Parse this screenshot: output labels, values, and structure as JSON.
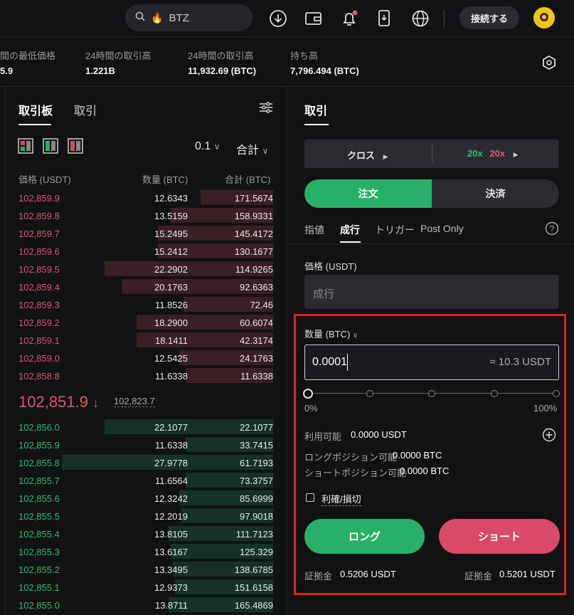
{
  "search": {
    "value": "BTZ"
  },
  "header": {
    "connect_label": "接続する"
  },
  "stats": [
    {
      "label": "間の最低価格",
      "value": "5.9"
    },
    {
      "label": "24時間の取引高",
      "value": "1.221B"
    },
    {
      "label": "24時間の取引高",
      "value": "11,932.69 (BTC)"
    },
    {
      "label": "持ち高",
      "value": "7,796.494 (BTC)"
    }
  ],
  "orderbook": {
    "tabs": [
      "取引板",
      "取引"
    ],
    "step": "0.1",
    "total_mode": "合計",
    "headers": {
      "price": "価格 (USDT)",
      "qty": "数量 (BTC)",
      "total": "合計 (BTC)"
    },
    "asks": [
      {
        "price": "102,859.9",
        "qty": "12.6343",
        "total": "171.5674",
        "depth": 0.34
      },
      {
        "price": "102,859.8",
        "qty": "13.5159",
        "total": "158.9331",
        "depth": 0.48
      },
      {
        "price": "102,859.7",
        "qty": "15.2495",
        "total": "145.4172",
        "depth": 0.54
      },
      {
        "price": "102,859.6",
        "qty": "15.2412",
        "total": "130.1677",
        "depth": 0.54
      },
      {
        "price": "102,859.5",
        "qty": "22.2902",
        "total": "114.9265",
        "depth": 0.79
      },
      {
        "price": "102,859.4",
        "qty": "20.1763",
        "total": "92.6363",
        "depth": 0.71
      },
      {
        "price": "102,859.3",
        "qty": "11.8526",
        "total": "72.46",
        "depth": 0.42
      },
      {
        "price": "102,859.2",
        "qty": "18.2900",
        "total": "60.6074",
        "depth": 0.64
      },
      {
        "price": "102,859.1",
        "qty": "18.1411",
        "total": "42.3174",
        "depth": 0.64
      },
      {
        "price": "102,859.0",
        "qty": "12.5425",
        "total": "24.1763",
        "depth": 0.44
      },
      {
        "price": "102,858.8",
        "qty": "11.6338",
        "total": "11.6338",
        "depth": 0.41
      }
    ],
    "last_price": "102,851.9",
    "mark_price": "102,823.7",
    "bids": [
      {
        "price": "102,856.0",
        "qty": "22.1077",
        "total": "22.1077",
        "depth": 0.79
      },
      {
        "price": "102,855.9",
        "qty": "11.6338",
        "total": "33.7415",
        "depth": 0.41
      },
      {
        "price": "102,855.8",
        "qty": "27.9778",
        "total": "61.7193",
        "depth": 0.99
      },
      {
        "price": "102,855.7",
        "qty": "11.6564",
        "total": "73.3757",
        "depth": 0.41
      },
      {
        "price": "102,855.6",
        "qty": "12.3242",
        "total": "85.6999",
        "depth": 0.44
      },
      {
        "price": "102,855.5",
        "qty": "12.2019",
        "total": "97.9018",
        "depth": 0.43
      },
      {
        "price": "102,855.4",
        "qty": "13.8105",
        "total": "111.7123",
        "depth": 0.49
      },
      {
        "price": "102,855.3",
        "qty": "13.6167",
        "total": "125.329",
        "depth": 0.48
      },
      {
        "price": "102,855.2",
        "qty": "13.3495",
        "total": "138.6785",
        "depth": 0.47
      },
      {
        "price": "102,855.1",
        "qty": "12.9373",
        "total": "151.6158",
        "depth": 0.46
      },
      {
        "price": "102,855.0",
        "qty": "13.8711",
        "total": "165.4869",
        "depth": 0.49
      }
    ]
  },
  "trade": {
    "title": "取引",
    "margin_mode": "クロス",
    "leverage_long": "20x",
    "leverage_short": "20x",
    "open_label": "注文",
    "close_label": "決済",
    "order_types": [
      "指値",
      "成行",
      "トリガー",
      "Post Only"
    ],
    "price_label": "価格 (USDT)",
    "price_placeholder": "成行",
    "qty_label": "数量 (BTC)",
    "qty_value": "0.0001",
    "qty_equiv": "≈ 10.3 USDT",
    "slider": {
      "min": "0%",
      "max": "100%",
      "value": 0
    },
    "available_label": "利用可能",
    "available_value": "0.0000 USDT",
    "long_avail_label": "ロングポジション可能",
    "long_avail_value": "0.0000 BTC",
    "short_avail_label": "ショートポジション可能",
    "short_avail_value": "0.0000 BTC",
    "tpsl_label": "利確/損切",
    "long_label": "ロング",
    "short_label": "ショート",
    "margin_long_label": "証拠金",
    "margin_long_value": "0.5206 USDT",
    "margin_short_label": "証拠金",
    "margin_short_value": "0.5201 USDT"
  },
  "colors": {
    "green": "#29b068",
    "red": "#d94a68",
    "highlight": "#d92129"
  }
}
